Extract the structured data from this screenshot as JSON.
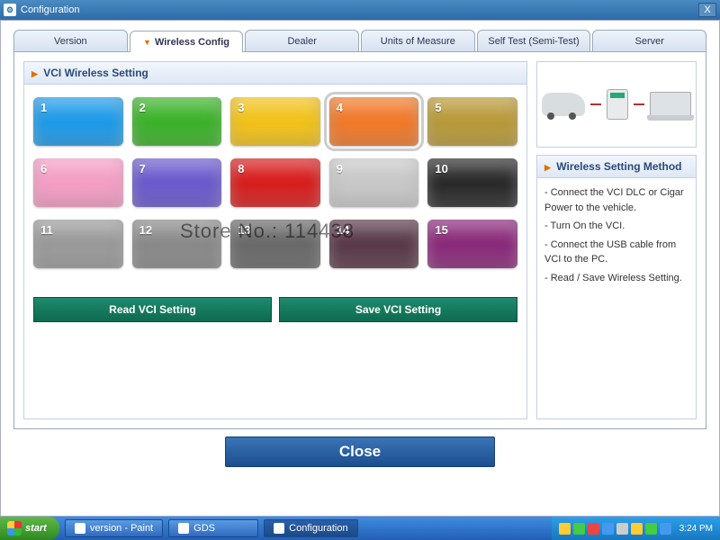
{
  "window": {
    "title": "Configuration",
    "close_x": "X"
  },
  "tabs": [
    {
      "label": "Version"
    },
    {
      "label": "Wireless Config",
      "active": true
    },
    {
      "label": "Dealer"
    },
    {
      "label": "Units of Measure"
    },
    {
      "label": "Self Test (Semi-Test)"
    },
    {
      "label": "Server"
    }
  ],
  "section": {
    "title": "VCI Wireless Setting"
  },
  "tiles": [
    {
      "n": "1",
      "color": "#1e9be8"
    },
    {
      "n": "2",
      "color": "#3cb22a"
    },
    {
      "n": "3",
      "color": "#f2c21a"
    },
    {
      "n": "4",
      "color": "#f07a2a",
      "selected": true
    },
    {
      "n": "5",
      "color": "#b89a3a"
    },
    {
      "n": "6",
      "color": "#f49ec4"
    },
    {
      "n": "7",
      "color": "#6a5acd"
    },
    {
      "n": "8",
      "color": "#d81e1e"
    },
    {
      "n": "9",
      "color": "#c8c8c8"
    },
    {
      "n": "10",
      "color": "#2a2a2a"
    },
    {
      "n": "11",
      "color": "#9a9a9a"
    },
    {
      "n": "12",
      "color": "#8a8a8a"
    },
    {
      "n": "13",
      "color": "#6a6a6a"
    },
    {
      "n": "14",
      "color": "#5a3a4a"
    },
    {
      "n": "15",
      "color": "#8a2a7a"
    }
  ],
  "actions": {
    "read": "Read VCI Setting",
    "save": "Save VCI Setting"
  },
  "method": {
    "header": "Wireless Setting Method",
    "steps": [
      "- Connect the VCI DLC or Cigar Power to the vehicle.",
      "- Turn On the VCI.",
      "- Connect the USB cable from VCI to the PC.",
      "- Read / Save Wireless Setting."
    ]
  },
  "watermark": "Store No.: 114438",
  "close_button": "Close",
  "taskbar": {
    "start": "start",
    "items": [
      {
        "label": "version - Paint"
      },
      {
        "label": "GDS"
      },
      {
        "label": "Configuration",
        "active": true
      }
    ],
    "clock": "3:24 PM"
  }
}
